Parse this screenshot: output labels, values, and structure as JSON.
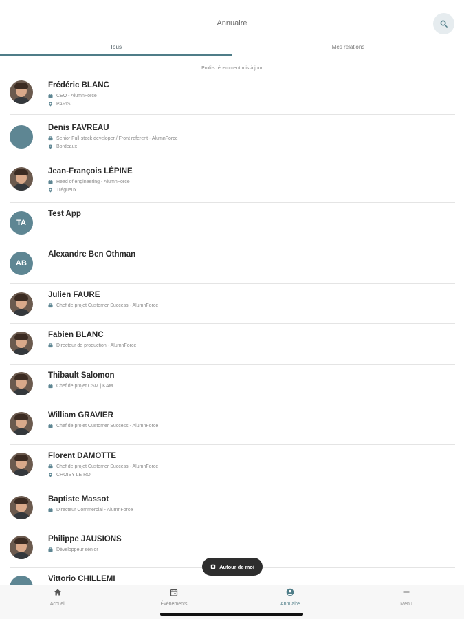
{
  "header": {
    "title": "Annuaire",
    "search_icon": "search-icon"
  },
  "tabs": [
    {
      "label": "Tous",
      "active": true
    },
    {
      "label": "Mes relations",
      "active": false
    }
  ],
  "section_label": "Profils récemment mis à jour",
  "people": [
    {
      "name": "Frédéric BLANC",
      "job": "CEO - AlumnForce",
      "location": "PARIS",
      "avatar": "photo"
    },
    {
      "name": "Denis FAVREAU",
      "job": "Senior Full-stack developer / Front referent - AlumnForce",
      "location": "Bordeaux",
      "avatar": "blank"
    },
    {
      "name": "Jean-François LÉPINE",
      "job": "Head of engineering - AlumnForce",
      "location": "Trégueux",
      "avatar": "photo"
    },
    {
      "name": "Test App",
      "job": "",
      "location": "",
      "avatar": "initials",
      "initials": "TA"
    },
    {
      "name": "Alexandre Ben Othman",
      "job": "",
      "location": "",
      "avatar": "initials",
      "initials": "AB"
    },
    {
      "name": "Julien FAURE",
      "job": "Chef de projet Customer Success - AlumnForce",
      "location": "",
      "avatar": "photo"
    },
    {
      "name": "Fabien BLANC",
      "job": "Directeur de production - AlumnForce",
      "location": "",
      "avatar": "photo"
    },
    {
      "name": "Thibault Salomon",
      "job": "Chef de projet CSM | KAM",
      "location": "",
      "avatar": "photo"
    },
    {
      "name": "William GRAVIER",
      "job": "Chef de projet Customer Success - AlumnForce",
      "location": "",
      "avatar": "photo"
    },
    {
      "name": "Florent DAMOTTE",
      "job": "Chef de projet Customer Success - AlumnForce",
      "location": "CHOISY LE ROI",
      "avatar": "photo"
    },
    {
      "name": "Baptiste Massot",
      "job": "Directeur Commercial - AlumnForce",
      "location": "",
      "avatar": "photo"
    },
    {
      "name": "Philippe JAUSIONS",
      "job": "Développeur sénior",
      "location": "",
      "avatar": "photo"
    },
    {
      "name": "Vittorio CHILLEMI",
      "job": "",
      "location": "",
      "avatar": "blank"
    }
  ],
  "fab": {
    "label": "Autour de moi",
    "icon": "map-icon"
  },
  "bottom_nav": [
    {
      "label": "Accueil",
      "icon": "home-icon",
      "active": false
    },
    {
      "label": "Événements",
      "icon": "calendar-icon",
      "active": false
    },
    {
      "label": "Annuaire",
      "icon": "person-icon",
      "active": true
    },
    {
      "label": "Menu",
      "icon": "menu-icon",
      "active": false
    }
  ],
  "colors": {
    "accent": "#4f7d88",
    "avatar_bg": "#5e8693",
    "fab_bg": "#2e2e2e"
  }
}
